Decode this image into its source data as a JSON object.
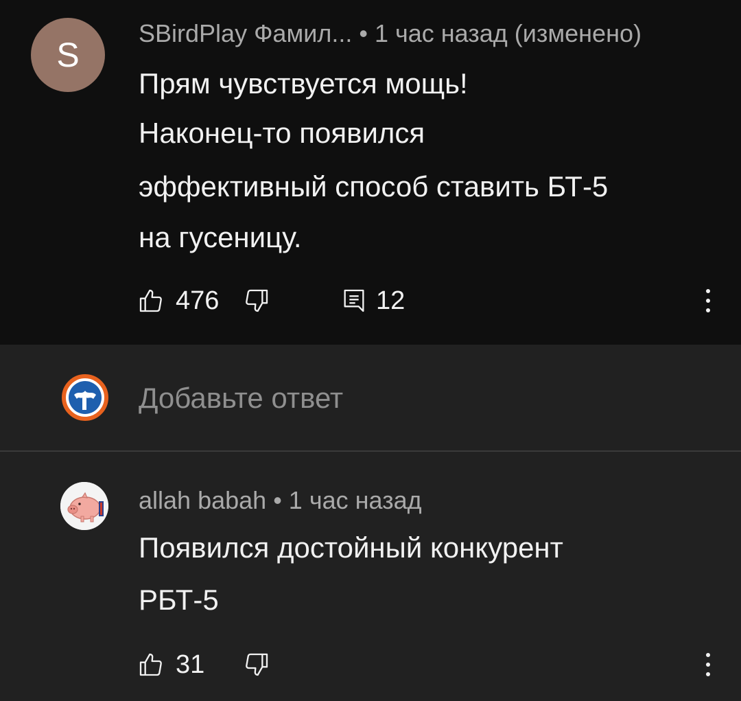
{
  "comment1": {
    "avatar_letter": "S",
    "author": "SBirdPlay Фамил...",
    "time": "1 час назад (изменено)",
    "lines": [
      "Прям чувствуется мощь!",
      "Наконец-то появился",
      "эффективный способ ставить БТ-5",
      "на гусеницу."
    ],
    "likes": "476",
    "replies": "12"
  },
  "reply_box": {
    "placeholder": "Добавьте ответ"
  },
  "comment2": {
    "author": "allah babah",
    "time": "1 час назад",
    "lines": [
      "Появился достойный конкурент",
      "РБТ-5"
    ],
    "likes": "31"
  },
  "icons": {
    "like": "thumb-up-icon",
    "dislike": "thumb-down-icon",
    "reply": "comment-icon",
    "more": "more-vertical-icon"
  },
  "colors": {
    "bg_top": "#0f0f0f",
    "bg_main": "#212121",
    "meta_text": "#aaaaaa",
    "avatar_s": "#957466",
    "user_avatar_ring": "#e8621e"
  }
}
